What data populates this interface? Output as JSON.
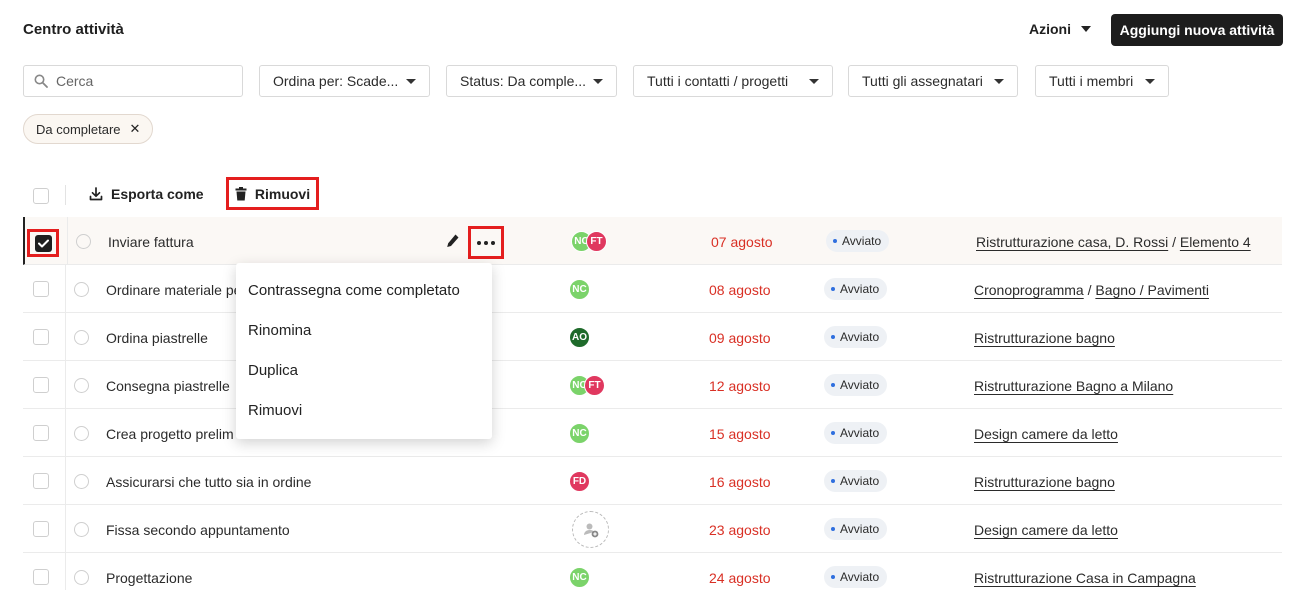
{
  "header": {
    "title": "Centro attività",
    "actions_label": "Azioni",
    "add_button_label": "Aggiungi nuova attività"
  },
  "filters": {
    "search_placeholder": "Cerca",
    "sort_label": "Ordina per: Scade...",
    "status_label": "Status: Da comple...",
    "contacts_label": "Tutti i contatti / progetti",
    "assignees_label": "Tutti gli assegnatari",
    "members_label": "Tutti i membri"
  },
  "active_chip": {
    "label": "Da completare",
    "remove_symbol": "✕"
  },
  "toolbar": {
    "export_label": "Esporta come",
    "remove_label": "Rimuovi"
  },
  "tasks": [
    {
      "name": "Inviare fattura",
      "selected": true,
      "assignees": [
        {
          "initials": "NC",
          "color": "#7bd36a"
        },
        {
          "initials": "FT",
          "color": "#e0385f"
        }
      ],
      "due": "07 agosto",
      "status": "Avviato",
      "project": [
        "Ristrutturazione casa, D. Rossi",
        "Elemento 4"
      ]
    },
    {
      "name": "Ordinare materiale pe",
      "selected": false,
      "assignees": [
        {
          "initials": "NC",
          "color": "#7bd36a"
        }
      ],
      "due": "08 agosto",
      "status": "Avviato",
      "project": [
        "Cronoprogramma",
        "Bagno / Pavimenti"
      ]
    },
    {
      "name": "Ordina piastrelle",
      "selected": false,
      "assignees": [
        {
          "initials": "AO",
          "color": "#1e6a2a"
        }
      ],
      "due": "09 agosto",
      "status": "Avviato",
      "project": [
        "Ristrutturazione bagno"
      ]
    },
    {
      "name": "Consegna piastrelle",
      "selected": false,
      "assignees": [
        {
          "initials": "NC",
          "color": "#7bd36a"
        },
        {
          "initials": "FT",
          "color": "#e0385f"
        }
      ],
      "due": "12 agosto",
      "status": "Avviato",
      "project": [
        "Ristrutturazione Bagno a Milano"
      ]
    },
    {
      "name": "Crea progetto prelim",
      "selected": false,
      "assignees": [
        {
          "initials": "NC",
          "color": "#7bd36a"
        }
      ],
      "due": "15 agosto",
      "status": "Avviato",
      "project": [
        "Design camere da letto"
      ]
    },
    {
      "name": "Assicurarsi che tutto sia in ordine",
      "selected": false,
      "assignees": [
        {
          "initials": "FD",
          "color": "#e0385f"
        }
      ],
      "due": "16 agosto",
      "status": "Avviato",
      "project": [
        "Ristrutturazione bagno"
      ]
    },
    {
      "name": "Fissa secondo appuntamento",
      "selected": false,
      "assignees": [],
      "due": "23 agosto",
      "status": "Avviato",
      "project": [
        "Design camere da letto"
      ]
    },
    {
      "name": "Progettazione",
      "selected": false,
      "assignees": [
        {
          "initials": "NC",
          "color": "#7bd36a"
        }
      ],
      "due": "24 agosto",
      "status": "Avviato",
      "project": [
        "Ristrutturazione Casa in Campagna"
      ]
    }
  ],
  "context_menu": {
    "items": [
      "Contrassegna come completato",
      "Rinomina",
      "Duplica",
      "Rimuovi"
    ]
  },
  "project_separator": "/"
}
